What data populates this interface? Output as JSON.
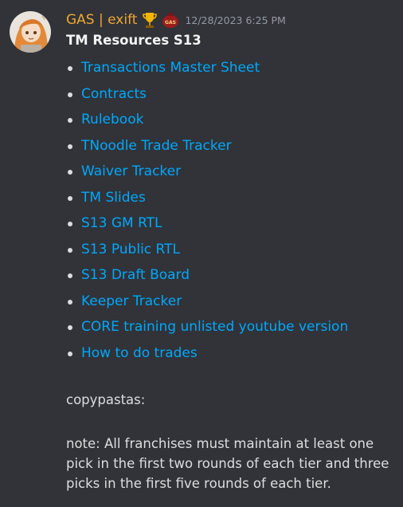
{
  "message": {
    "author": "GAS | exift",
    "timestamp": "12/28/2023 6:25 PM",
    "role_badge_text": "GAS",
    "title": "TM Resources S13",
    "links": [
      "Transactions Master Sheet",
      "Contracts",
      "Rulebook",
      "TNoodle Trade Tracker",
      "Waiver Tracker",
      "TM Slides",
      "S13 GM RTL",
      "S13 Public RTL",
      "S13 Draft Board",
      "Keeper Tracker",
      "CORE training unlisted youtube version",
      "How to do trades"
    ],
    "copypastas_label": "copypastas:",
    "note": "note: All franchises must maintain at least one pick in the first two rounds of each tier and three picks in the first five rounds of each tier."
  },
  "colors": {
    "background": "#313338",
    "username": "#f0a732",
    "link": "#00a8fc",
    "text": "#dbdee1",
    "timestamp": "#949ba4"
  },
  "icons": {
    "avatar": "anime-avatar",
    "trophy": "trophy-icon",
    "role": "gas-can-icon"
  }
}
